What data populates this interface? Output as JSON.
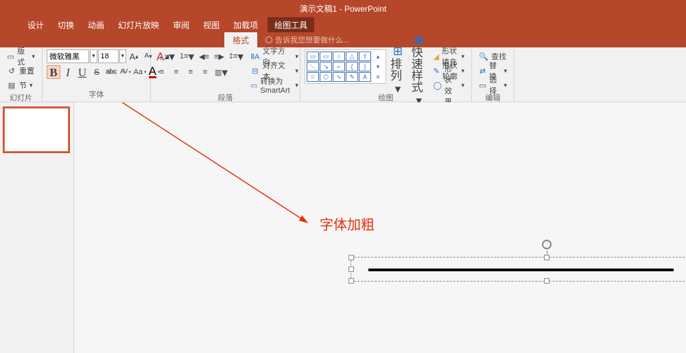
{
  "title": "演示文稿1 - PowerPoint",
  "contextual_tab": "绘图工具",
  "tabs": [
    "设计",
    "切换",
    "动画",
    "幻灯片放映",
    "审阅",
    "视图",
    "加载项"
  ],
  "subtab_active": "格式",
  "tellme": "告诉我您想要做什么...",
  "slides_group": {
    "layout": "版式",
    "reset": "重置",
    "section": "节",
    "label": "幻灯片"
  },
  "font": {
    "name": "微软雅黑",
    "size": "18",
    "grow": "A",
    "shrink": "A",
    "clear": "A",
    "bold": "B",
    "italic": "I",
    "underline": "U",
    "strike": "S",
    "shadow": "abc",
    "spacing": "AV",
    "case": "Aa",
    "color": "A",
    "label": "字体"
  },
  "paragraph": {
    "textdir": "文字方向",
    "align": "对齐文本",
    "smartart": "转换为 SmartArt",
    "label": "段落"
  },
  "drawing": {
    "arrange": "排列",
    "quickstyle": "快速样式",
    "fill": "形状填充",
    "outline": "形状轮廓",
    "effects": "形状效果",
    "label": "绘图"
  },
  "editing": {
    "find": "查找",
    "replace": "替换",
    "select": "选择",
    "label": "编辑"
  },
  "annotation": "字体加粗"
}
